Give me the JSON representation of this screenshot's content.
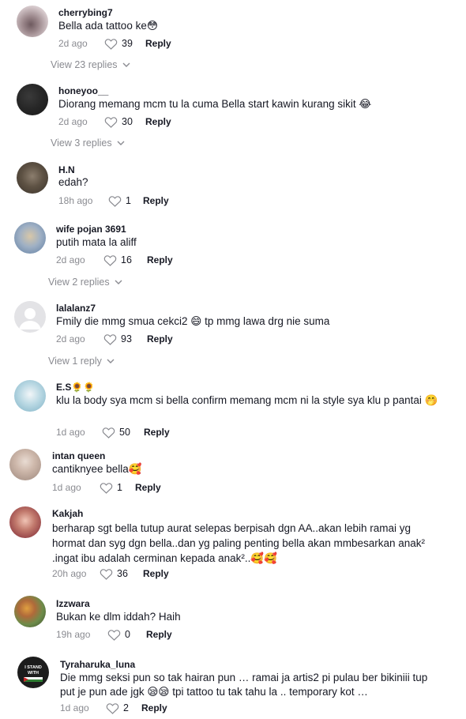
{
  "comments": [
    {
      "username": "cherrybing7",
      "text": "Bella ada tattoo ke😳",
      "time": "2d ago",
      "likes": "39",
      "reply": "Reply",
      "view_replies": "View 23 replies"
    },
    {
      "username": "honeyoo__",
      "text": "Diorang memang mcm tu la cuma Bella start kawin kurang sikit 😂",
      "time": "2d ago",
      "likes": "30",
      "reply": "Reply",
      "view_replies": "View 3 replies"
    },
    {
      "username": "H.N",
      "text": "edah?",
      "time": "18h ago",
      "likes": "1",
      "reply": "Reply"
    },
    {
      "username": "wife pojan 3691",
      "text": "putih mata la aliff",
      "time": "2d ago",
      "likes": "16",
      "reply": "Reply",
      "view_replies": "View 2 replies"
    },
    {
      "username": "lalalanz7",
      "text": "Fmily die mmg smua cekci2 😄 tp mmg lawa drg nie suma",
      "time": "2d ago",
      "likes": "93",
      "reply": "Reply",
      "view_replies": "View 1 reply"
    },
    {
      "username": "E.S🌻🌻",
      "text": "klu la body sya mcm si bella confirm memang mcm ni la style sya klu p pantai 🤭",
      "time": "1d ago",
      "likes": "50",
      "reply": "Reply"
    },
    {
      "username": "intan queen",
      "text": "cantiknyee bella🥰",
      "time": "1d ago",
      "likes": "1",
      "reply": "Reply"
    },
    {
      "username": "Kakjah",
      "text": "berharap sgt bella tutup aurat selepas berpisah dgn AA..akan lebih ramai yg hormat dan syg dgn bella..dan yg paling penting bella akan mmbesarkan anak² .ingat ibu adalah cerminan kepada anak²..🥰🥰",
      "time": "20h ago",
      "likes": "36",
      "reply": "Reply"
    },
    {
      "username": "Izzwara",
      "text": "Bukan ke dlm iddah? Haih",
      "time": "19h ago",
      "likes": "0",
      "reply": "Reply"
    },
    {
      "username": "Tyraharuka_luna",
      "text": "Die mmg seksi pun so tak hairan pun … ramai ja artis2 pi pulau ber bikiniii tup put je pun ade jgk 😪😪 tpi tattoo tu tak tahu la .. temporary kot …",
      "time": "1d ago",
      "likes": "2",
      "reply": "Reply",
      "avatar_text": [
        "I STAND",
        "WITH"
      ]
    }
  ]
}
